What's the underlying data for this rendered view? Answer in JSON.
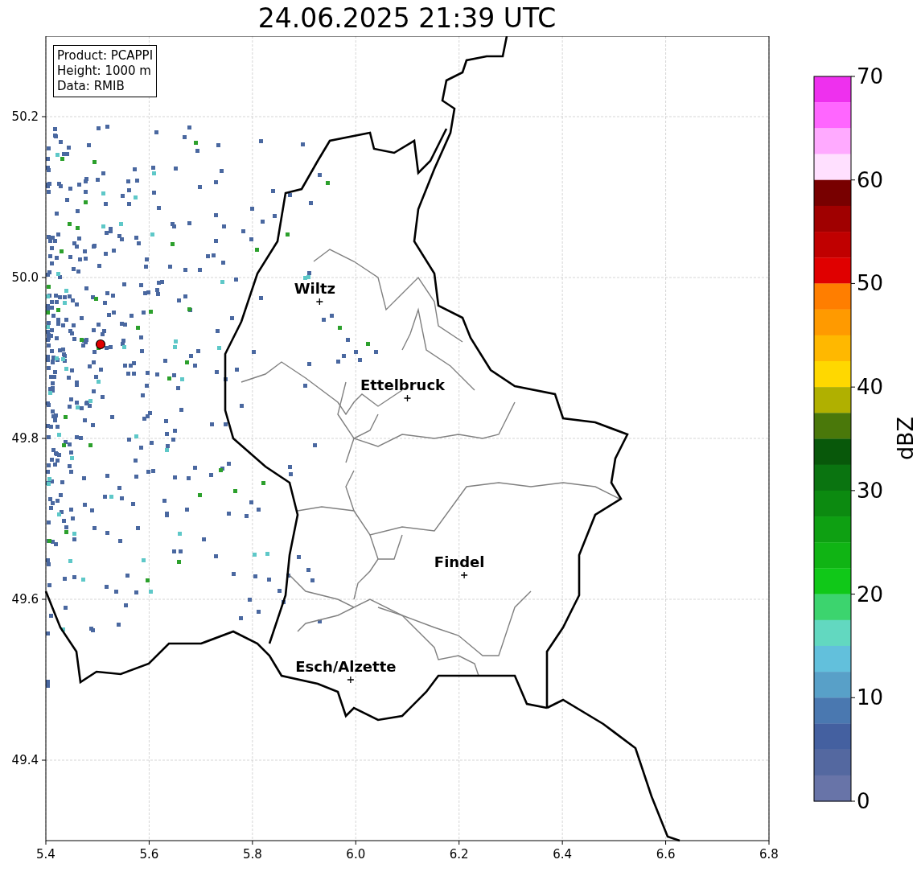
{
  "title": "24.06.2025 21:39 UTC",
  "info_box": [
    "Product: PCAPPI",
    "Height: 1000 m",
    "Data: RMIB"
  ],
  "map": {
    "chart_data": {
      "type": "scatter",
      "grid": true,
      "xlim": [
        5.4,
        6.8
      ],
      "ylim": [
        49.3,
        50.3
      ],
      "x": [
        5.93,
        6.1,
        6.21,
        5.99
      ],
      "series": [
        {
          "color": "#000000",
          "values": [
            49.97,
            49.85,
            49.63,
            49.5
          ]
        }
      ],
      "xticks": [
        {
          "value": 5.4,
          "label": "5.4"
        },
        {
          "value": 5.6,
          "label": "5.6"
        },
        {
          "value": 5.8,
          "label": "5.8"
        },
        {
          "value": 6.0,
          "label": "6.0"
        },
        {
          "value": 6.2,
          "label": "6.2"
        },
        {
          "value": 6.4,
          "label": "6.4"
        },
        {
          "value": 6.6,
          "label": "6.6"
        },
        {
          "value": 6.8,
          "label": "6.8"
        }
      ],
      "yticks": [
        {
          "value": 50.2,
          "label": "50.2"
        },
        {
          "value": 50.0,
          "label": "50.0"
        },
        {
          "value": 49.8,
          "label": "49.8"
        },
        {
          "value": 49.6,
          "label": "49.6"
        },
        {
          "value": 49.4,
          "label": "49.4"
        }
      ]
    },
    "cities": [
      "Wiltz",
      "Ettelbruck",
      "Findel",
      "Esch/Alzette"
    ]
  },
  "colorbar": {
    "label": "dBZ",
    "ticks": [
      "70",
      "60",
      "50",
      "40",
      "30",
      "20",
      "10",
      "0"
    ],
    "levels": [
      {
        "color": "#ee30ee"
      },
      {
        "color": "#ff66ff"
      },
      {
        "color": "#ffaaff"
      },
      {
        "color": "#ffe0ff"
      },
      {
        "color": "#780000"
      },
      {
        "color": "#a00000"
      },
      {
        "color": "#c00000"
      },
      {
        "color": "#e00000"
      },
      {
        "color": "#ff7e00"
      },
      {
        "color": "#ff9a00"
      },
      {
        "color": "#ffb800"
      },
      {
        "color": "#ffd800"
      },
      {
        "color": "#b0b000"
      },
      {
        "color": "#4a780a"
      },
      {
        "color": "#08580a"
      },
      {
        "color": "#0a7410"
      },
      {
        "color": "#0c8a10"
      },
      {
        "color": "#0ea012"
      },
      {
        "color": "#10b414"
      },
      {
        "color": "#10c818"
      },
      {
        "color": "#3cd46e"
      },
      {
        "color": "#62d8c0"
      },
      {
        "color": "#62c0dc"
      },
      {
        "color": "#58a0c8"
      },
      {
        "color": "#4a78b0"
      },
      {
        "color": "#4460a0"
      },
      {
        "color": "#5468a0"
      },
      {
        "color": "#6874a8"
      }
    ]
  }
}
